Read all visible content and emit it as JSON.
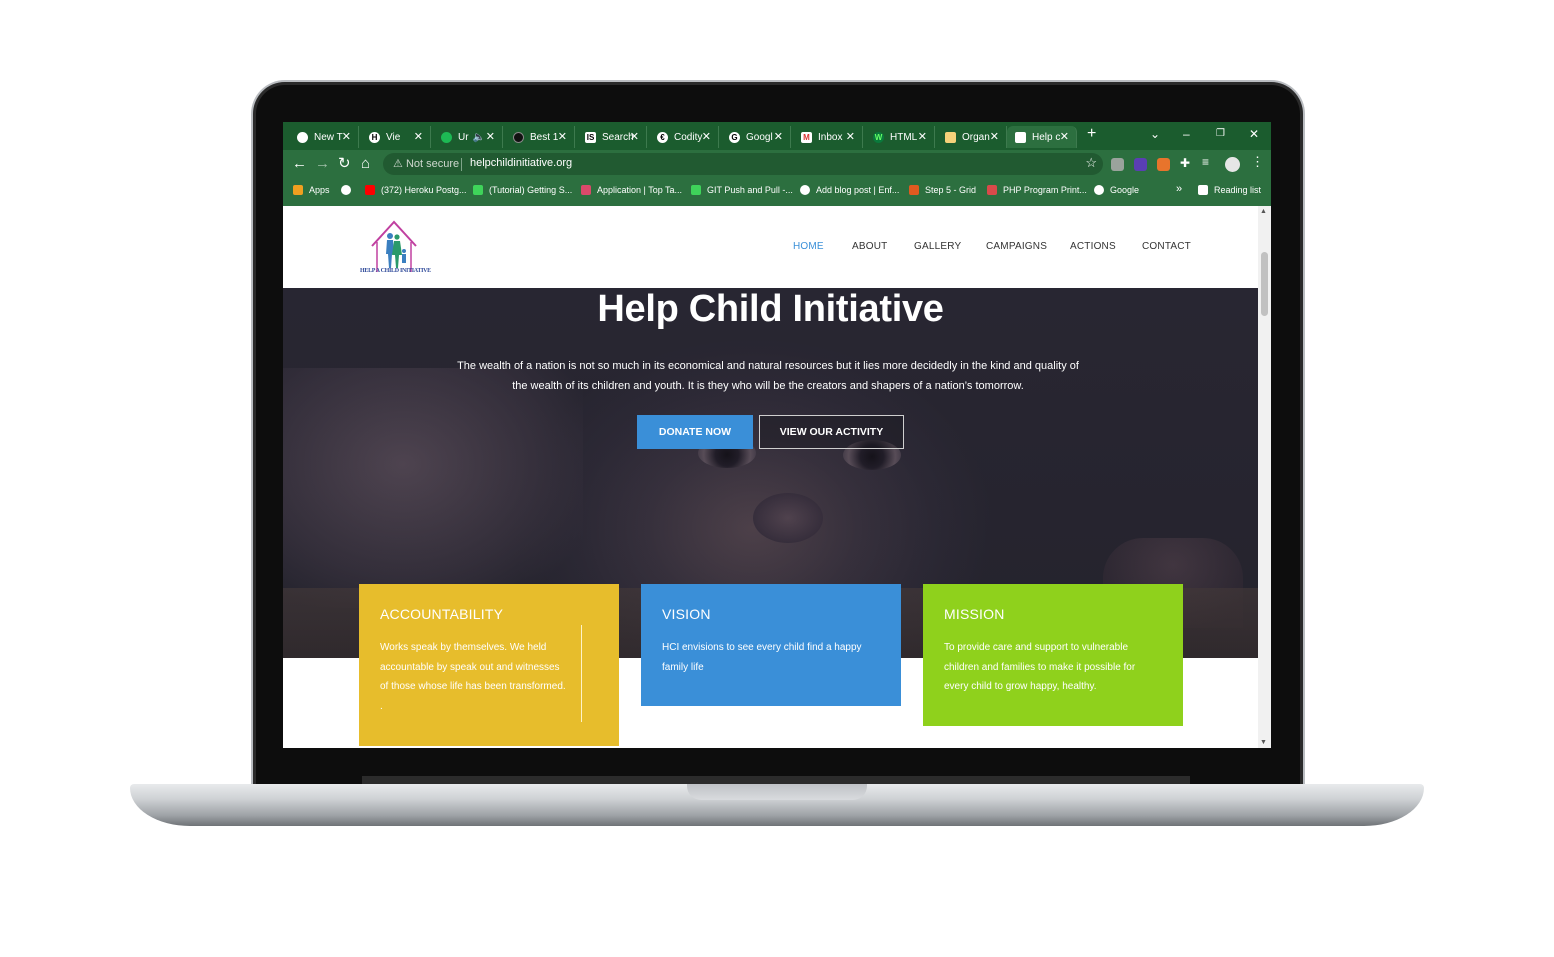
{
  "browser": {
    "tabs": [
      {
        "label": "New T",
        "icon": "chrome-icon",
        "color": "#ffffff"
      },
      {
        "label": "Vie",
        "icon": "h-icon",
        "color": "#111111"
      },
      {
        "label": "Ur",
        "icon": "spotify-icon",
        "color": "#1db954"
      },
      {
        "label": "Best 1",
        "icon": "generic-icon",
        "color": "#111111"
      },
      {
        "label": "Search",
        "icon": "is-icon",
        "color": "#111111"
      },
      {
        "label": "Codity",
        "icon": "codility-icon",
        "color": "#111111"
      },
      {
        "label": "Googl",
        "icon": "google-icon",
        "color": "#ffffff"
      },
      {
        "label": "Inbox",
        "icon": "gmail-icon",
        "color": "#ffffff"
      },
      {
        "label": "HTML",
        "icon": "w-icon",
        "color": "#0a7a3c"
      },
      {
        "label": "Organ",
        "icon": "note-icon",
        "color": "#f5d27a"
      },
      {
        "label": "Help c",
        "icon": "site-icon",
        "color": "#ffffff"
      }
    ],
    "url_warning": "Not secure",
    "url": "helpchildinitiative.org",
    "bookmarks": [
      {
        "label": "Apps",
        "color": "#f0a020"
      },
      {
        "label": "",
        "color": "#ffffff"
      },
      {
        "label": "(372) Heroku Postg...",
        "color": "#ff0000"
      },
      {
        "label": "(Tutorial) Getting S...",
        "color": "#3fd35a"
      },
      {
        "label": "Application | Top Ta...",
        "color": "#d94a6a"
      },
      {
        "label": "GIT Push and Pull -...",
        "color": "#3fd35a"
      },
      {
        "label": "Add blog post | Enf...",
        "color": "#ffffff"
      },
      {
        "label": "Step 5 - Grid",
        "color": "#e05a20"
      },
      {
        "label": "PHP Program Print...",
        "color": "#d94a4a"
      },
      {
        "label": "Google",
        "color": "#ffffff"
      }
    ],
    "reading_list": "Reading list",
    "more_bookmarks": "»"
  },
  "site": {
    "logo_text": "HELP A CHILD INITIATIVE",
    "nav": [
      "HOME",
      "ABOUT",
      "GALLERY",
      "CAMPAIGNS",
      "ACTIONS",
      "CONTACT"
    ],
    "hero": {
      "title": "Help Child Initiative",
      "text": "The wealth of a nation is not so much in its economical and natural resources but it lies more decidedly in the kind and quality of the wealth of its children and youth. It is they who will be the creators and shapers of a nation’s tomorrow.",
      "donate_label": "DONATE NOW",
      "activity_label": "VIEW OUR ACTIVITY"
    },
    "cards": [
      {
        "title": "ACCOUNTABILITY",
        "text": "Works speak by themselves. We held accountable by speak out and witnesses of those whose life has been transformed. .",
        "color": "#e7bd2c"
      },
      {
        "title": "VISION",
        "text": "HCI envisions to see every child find a happy family life",
        "color": "#3a8fd8"
      },
      {
        "title": "MISSION",
        "text": "To provide care and support to vulnerable children and families to make it possible for every child to grow happy, healthy.",
        "color": "#8fd11c"
      }
    ]
  }
}
